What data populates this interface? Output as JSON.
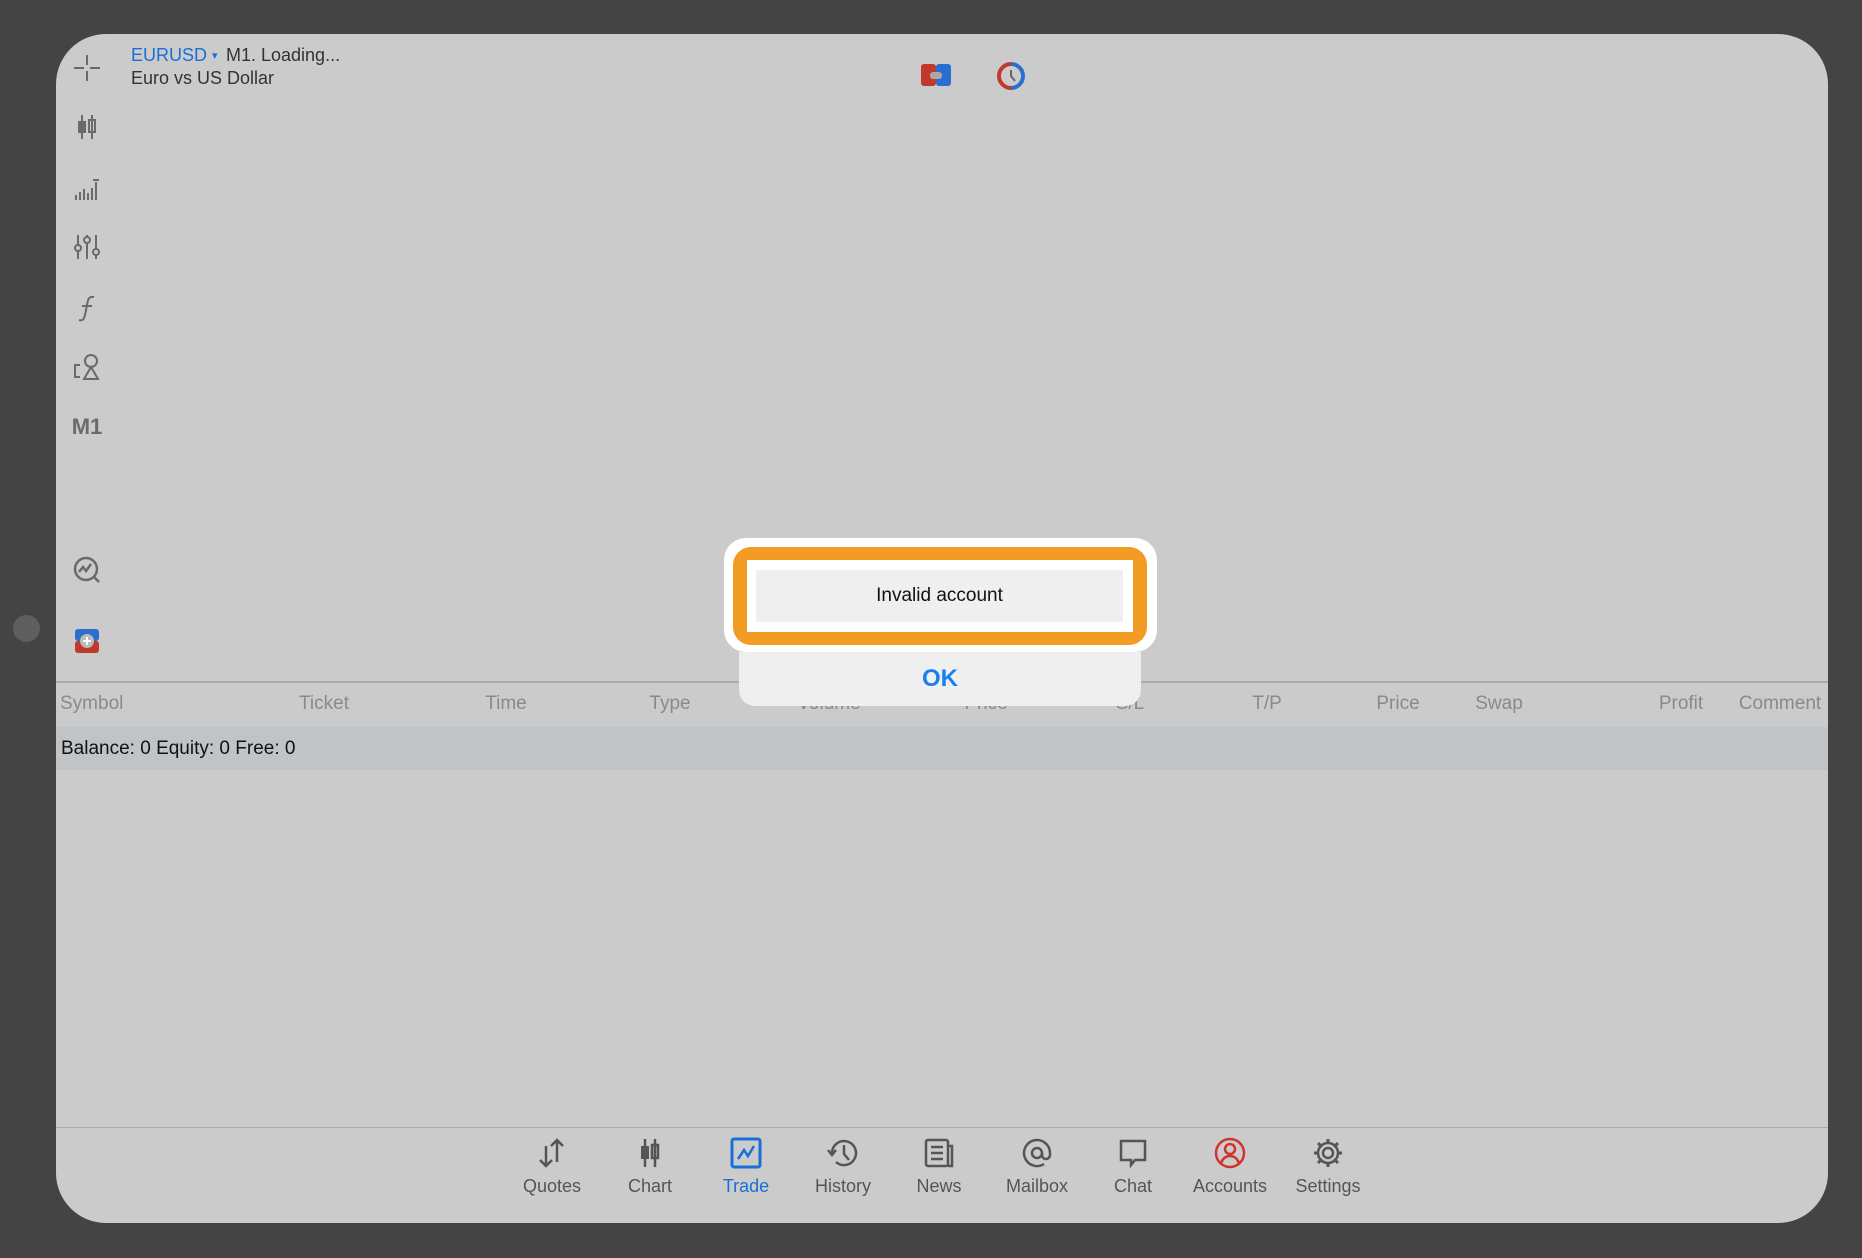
{
  "header": {
    "symbol": "EURUSD",
    "dropdown_arrow": "▾",
    "status": "M1. Loading...",
    "description": "Euro vs US Dollar"
  },
  "toolbar": {
    "timeframe": "M1",
    "icons": [
      "crosshair-icon",
      "candlestick-icon",
      "volume-bars-icon",
      "sliders-icon",
      "function-icon",
      "objects-icon",
      "chart-search-icon",
      "one-click-trading-icon"
    ]
  },
  "top_icons": [
    "one-click-trade-icon",
    "trade-clock-icon"
  ],
  "table": {
    "columns": [
      "Symbol",
      "Ticket",
      "Time",
      "Type",
      "Volume",
      "Price",
      "S/L",
      "T/P",
      "Price",
      "Swap",
      "Profit",
      "Comment"
    ]
  },
  "balance": "Balance: 0 Equity: 0 Free: 0",
  "dialog": {
    "message": "Invalid account",
    "ok": "OK"
  },
  "tabs": [
    {
      "label": "Quotes",
      "icon": "quotes-arrows-icon"
    },
    {
      "label": "Chart",
      "icon": "candlestick-icon"
    },
    {
      "label": "Trade",
      "icon": "trade-chart-icon",
      "active": true
    },
    {
      "label": "History",
      "icon": "history-clock-icon"
    },
    {
      "label": "News",
      "icon": "newspaper-icon"
    },
    {
      "label": "Mailbox",
      "icon": "at-sign-icon"
    },
    {
      "label": "Chat",
      "icon": "chat-bubble-icon"
    },
    {
      "label": "Accounts",
      "icon": "account-user-icon"
    },
    {
      "label": "Settings",
      "icon": "gear-icon"
    }
  ],
  "colors": {
    "accent": "#1a6fd6",
    "highlight": "#f39c24",
    "accounts_icon": "#d0352b"
  }
}
